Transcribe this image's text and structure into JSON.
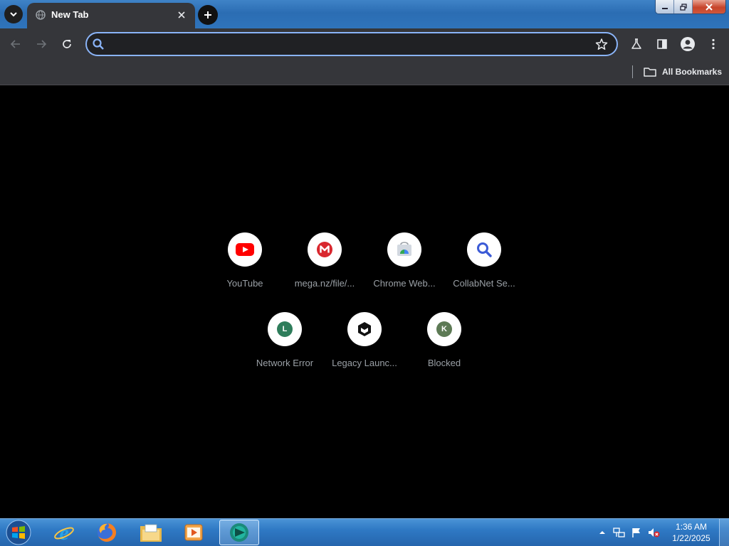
{
  "tab": {
    "title": "New Tab"
  },
  "omnibox": {
    "value": "",
    "placeholder": ""
  },
  "bookmarks": {
    "all_label": "All Bookmarks"
  },
  "shortcuts": [
    {
      "label": "YouTube",
      "icon": "youtube-icon",
      "color": "#ff0000"
    },
    {
      "label": "mega.nz/file/...",
      "icon": "mega-icon",
      "color": "#d9272e"
    },
    {
      "label": "Chrome Web...",
      "icon": "chrome-web-store-icon",
      "color": "#4285f4"
    },
    {
      "label": "CollabNet Se...",
      "icon": "search-icon",
      "color": "#3c5bd6"
    },
    {
      "label": "Network Error",
      "icon": "letter-L-icon",
      "letter": "L",
      "color": "#2e7d5b"
    },
    {
      "label": "Legacy Launc...",
      "icon": "legacy-launcher-icon",
      "color": "#111111"
    },
    {
      "label": "Blocked",
      "icon": "letter-K-icon",
      "letter": "K",
      "color": "#5d7a55"
    }
  ],
  "taskbar": {
    "apps": [
      "internet-explorer-icon",
      "firefox-icon",
      "file-explorer-icon",
      "media-player-icon",
      "chrome-active-icon"
    ],
    "clock": {
      "time": "1:36 AM",
      "date": "1/22/2025"
    }
  },
  "colors": {
    "accent": "#8ab4f8",
    "toolbar": "#35363a",
    "page_bg": "#000000",
    "taskbar": "#2f79c4"
  }
}
